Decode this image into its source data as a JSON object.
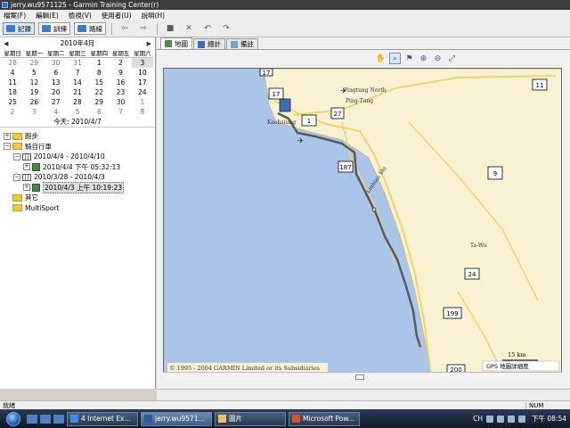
{
  "window": {
    "title": "jerry.wu9571125 - Garmin Training Center(r)"
  },
  "menu": [
    "檔案(F)",
    "編輯(E)",
    "檢視(V)",
    "使用者(U)",
    "說明(H)"
  ],
  "toolbar": {
    "buttons": [
      {
        "label": "記錄",
        "icon": "history-icon",
        "active": true
      },
      {
        "label": "訓練",
        "icon": "training-icon",
        "active": false
      },
      {
        "label": "路線",
        "icon": "routes-icon",
        "active": false
      }
    ]
  },
  "calendar": {
    "month": "2010年4月",
    "weekdays": [
      "星期日",
      "星期一",
      "星期二",
      "星期三",
      "星期四",
      "星期五",
      "星期六"
    ],
    "days": [
      [
        "28",
        "29",
        "30",
        "31",
        "1",
        "2",
        "3"
      ],
      [
        "4",
        "5",
        "6",
        "7",
        "8",
        "9",
        "10"
      ],
      [
        "11",
        "12",
        "13",
        "14",
        "15",
        "16",
        "17"
      ],
      [
        "18",
        "19",
        "20",
        "21",
        "22",
        "23",
        "24"
      ],
      [
        "25",
        "26",
        "27",
        "28",
        "29",
        "30",
        "1"
      ],
      [
        "2",
        "3",
        "4",
        "5",
        "6",
        "7",
        "8"
      ]
    ],
    "today": "今天: 2010/4/7"
  },
  "tree": {
    "running": "跑步",
    "biking": "騎自行車",
    "week1": "2010/4/4 - 2010/4/10",
    "act1": "2010/4/4 下午 05:32:13",
    "week2": "2010/3/28 - 2010/4/3",
    "act2": "2010/4/3 上午 10:19:23",
    "other": "其它",
    "multisport": "MultiSport"
  },
  "tabs": [
    "地圖",
    "總計",
    "備註"
  ],
  "map": {
    "labels": {
      "kaohsiung": "Kaohsiung",
      "pingtung_north": "Pingtung North",
      "pingtung": "Ping-Tung",
      "lianhua": "Linbian Shi",
      "taiwu": "Ta-Wu"
    },
    "roads": [
      "17",
      "17",
      "1",
      "27",
      "11",
      "187",
      "9",
      "24",
      "199",
      "200"
    ],
    "copyright": "© 1995 - 2004 GARMIN Limited or its Subsidiaries",
    "scale": "15 km",
    "detail": "GPS 地圖詳細度"
  },
  "status": {
    "ready": "就緒",
    "num": "NUM"
  },
  "taskbar": {
    "tasks": [
      {
        "label": "4 Internet Ex...",
        "icon": "ie-icon"
      },
      {
        "label": "jerry.wu9571...",
        "icon": "garmin-icon",
        "active": true
      },
      {
        "label": "圖片",
        "icon": "folder-icon"
      },
      {
        "label": "Microsoft Pow...",
        "icon": "powerpoint-icon"
      }
    ],
    "ime": "CH",
    "clock": "下午 08:54"
  },
  "colors": {
    "sea": "#a9c6ea",
    "land": "#f8f2d3",
    "route": "#5a5a5a",
    "road": "#f2d46a"
  }
}
